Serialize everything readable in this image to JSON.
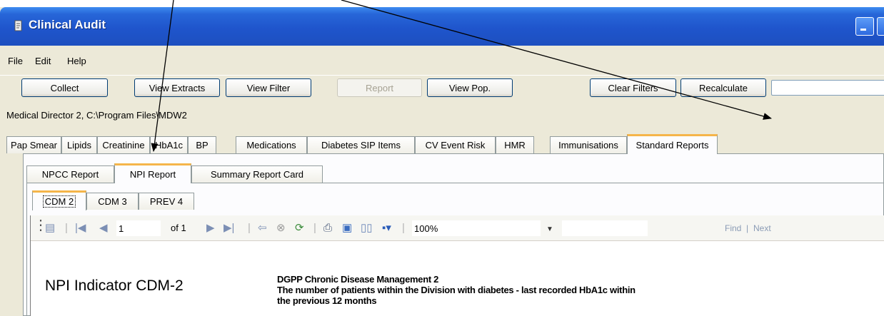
{
  "window": {
    "title": "Clinical Audit"
  },
  "menu": [
    "File",
    "Edit",
    "Help"
  ],
  "toolbar": {
    "collect": "Collect",
    "view_extracts": "View Extracts",
    "view_filter": "View Filter",
    "report": "Report",
    "view_pop": "View Pop.",
    "clear_filters": "Clear Filters",
    "recalculate": "Recalculate"
  },
  "datasource": "Medical Director 2, C:\\Program Files\\MDW2",
  "main_tabs": [
    "Pap Smear",
    "Lipids",
    "Creatinine",
    "HbA1c",
    "BP",
    "Medications",
    "Diabetes SIP Items",
    "CV Event Risk",
    "HMR",
    "Immunisations",
    "Standard Reports"
  ],
  "report_tabs": [
    "NPCC Report",
    "NPI Report",
    "Summary Report Card"
  ],
  "indicator_tabs": [
    "CDM 2",
    "CDM 3",
    "PREV 4"
  ],
  "viewer": {
    "page": "1",
    "of": "of 1",
    "zoom": "100%",
    "find": "Find",
    "separator": "|",
    "next": "Next"
  },
  "report": {
    "title": "NPI Indicator CDM-2",
    "line1": "DGPP Chronic Disease Management 2",
    "line2": "The number of patients within the Division with diabetes - last recorded HbA1c within",
    "line3": "the previous 12 months"
  },
  "colors": {
    "title_bar": "#1f55cc",
    "active_tab_accent": "#f5b54a",
    "window_bg": "#ece9d8"
  }
}
